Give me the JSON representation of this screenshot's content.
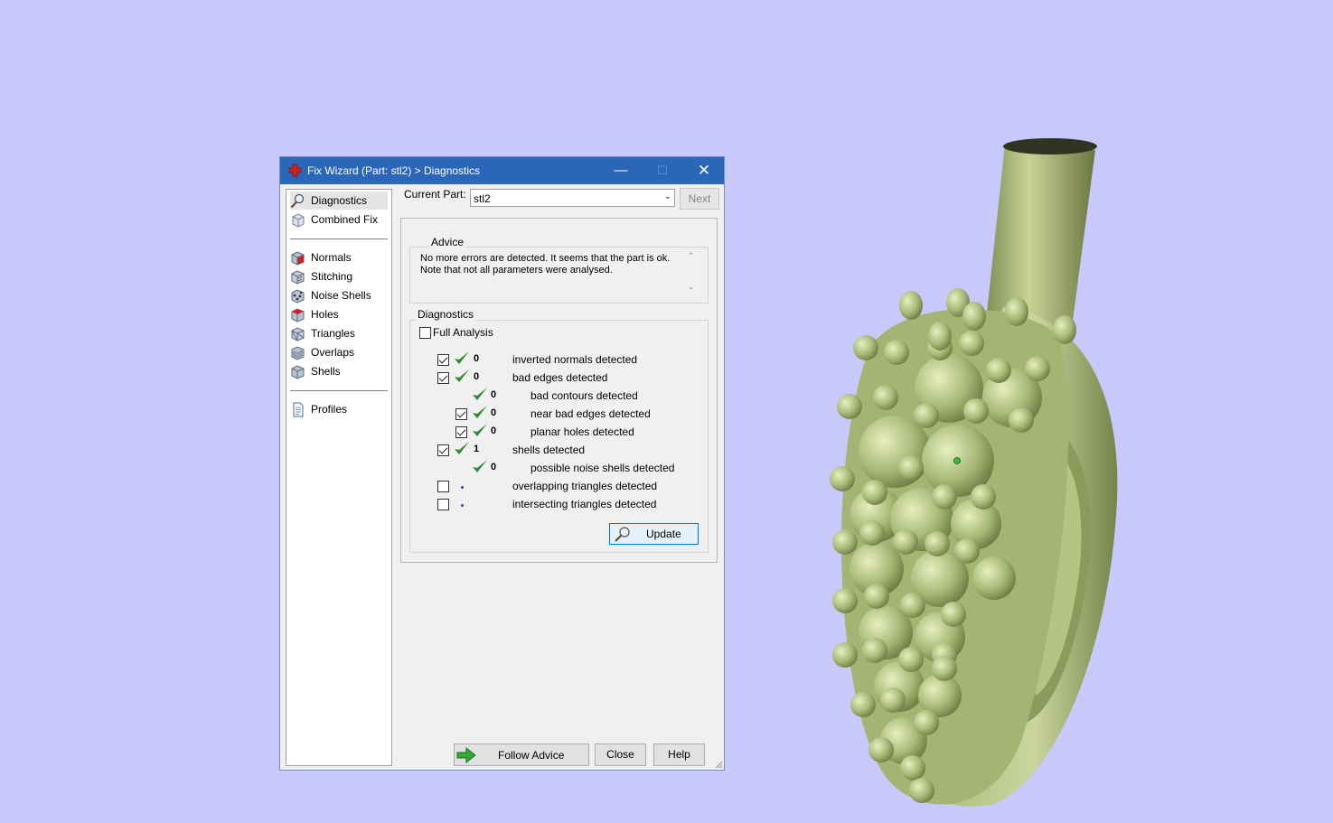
{
  "window": {
    "title": "Fix Wizard (Part: stl2) > Diagnostics",
    "minimize": "—",
    "maximize": "☐",
    "close": "✕"
  },
  "nav": {
    "items": [
      {
        "label": "Diagnostics",
        "icon": "magnifier-icon",
        "selected": true
      },
      {
        "label": "Combined Fix",
        "icon": "combined-fix-icon"
      },
      {
        "label": "Normals",
        "icon": "normals-cube-icon"
      },
      {
        "label": "Stitching",
        "icon": "stitching-cube-icon"
      },
      {
        "label": "Noise Shells",
        "icon": "noise-shells-cube-icon"
      },
      {
        "label": "Holes",
        "icon": "holes-cube-icon"
      },
      {
        "label": "Triangles",
        "icon": "triangles-cube-icon"
      },
      {
        "label": "Overlaps",
        "icon": "overlaps-cube-icon"
      },
      {
        "label": "Shells",
        "icon": "shells-cube-icon"
      },
      {
        "label": "Profiles",
        "icon": "document-icon"
      }
    ]
  },
  "current_part": {
    "label": "Current Part:",
    "value": "stl2",
    "next": "Next"
  },
  "advice": {
    "title": "Advice",
    "text_line1": "No more errors are detected. It seems that the part is ok.",
    "text_line2": "Note that not all parameters were analysed."
  },
  "diagnostics": {
    "title": "Diagnostics",
    "full_analysis": "Full Analysis",
    "rows": [
      {
        "count": "0",
        "label": "inverted normals detected"
      },
      {
        "count": "0",
        "label": "bad edges detected"
      },
      {
        "count": "0",
        "label": "bad contours detected"
      },
      {
        "count": "0",
        "label": "near bad edges detected"
      },
      {
        "count": "0",
        "label": "planar holes detected"
      },
      {
        "count": "1",
        "label": "shells detected"
      },
      {
        "count": "0",
        "label": "possible noise shells detected"
      },
      {
        "count": "",
        "label": "overlapping triangles detected"
      },
      {
        "count": "",
        "label": "intersecting triangles detected"
      }
    ],
    "update": "Update"
  },
  "footer": {
    "follow_advice": "Follow Advice",
    "close": "Close",
    "help": "Help"
  },
  "colors": {
    "background": "#c8c8fa",
    "titlebar": "#2b67b8",
    "check_green": "#2e8b2e",
    "model": "#a8b878"
  }
}
